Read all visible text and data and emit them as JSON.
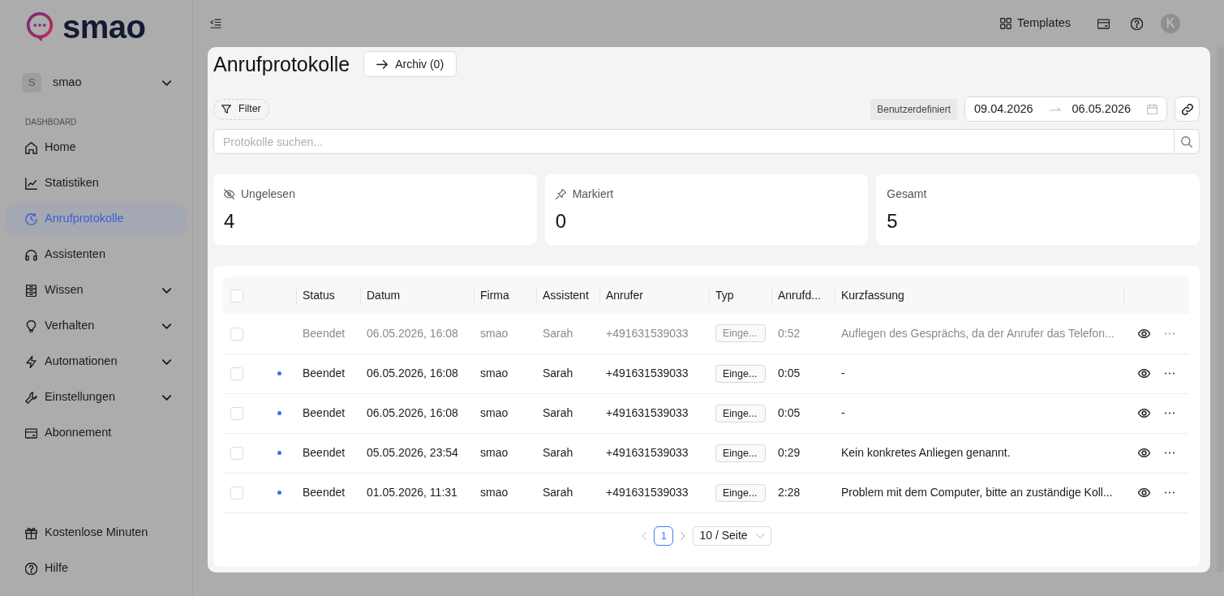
{
  "sidebar": {
    "logo_text": "smao",
    "workspace": {
      "initial": "S",
      "name": "smao"
    },
    "section": "DASHBOARD",
    "items": [
      {
        "label": "Home",
        "collapsible": false,
        "selected": false
      },
      {
        "label": "Statistiken",
        "collapsible": false,
        "selected": false
      },
      {
        "label": "Anrufprotokolle",
        "collapsible": false,
        "selected": true
      },
      {
        "label": "Assistenten",
        "collapsible": false,
        "selected": false
      },
      {
        "label": "Wissen",
        "collapsible": true,
        "selected": false
      },
      {
        "label": "Verhalten",
        "collapsible": true,
        "selected": false
      },
      {
        "label": "Automationen",
        "collapsible": true,
        "selected": false
      },
      {
        "label": "Einstellungen",
        "collapsible": true,
        "selected": false
      },
      {
        "label": "Abonnement",
        "collapsible": false,
        "selected": false
      }
    ],
    "footer_items": [
      {
        "label": "Kostenlose Minuten",
        "selected": false
      },
      {
        "label": "Hilfe",
        "selected": false
      }
    ]
  },
  "header": {
    "templates": "Templates",
    "avatar_initial": "K"
  },
  "page": {
    "title": "Anrufprotokolle",
    "archive_button": "Archiv (0)",
    "filter_button": "Filter",
    "range_preset": "Benutzerdefiniert",
    "date_from": "09.04.2026",
    "date_to": "06.05.2026",
    "search_placeholder": "Protokolle suchen..."
  },
  "stats": [
    {
      "label": "Ungelesen",
      "value": "4"
    },
    {
      "label": "Markiert",
      "value": "0"
    },
    {
      "label": "Gesamt",
      "value": "5"
    }
  ],
  "table": {
    "select_all_checked": false,
    "columns": [
      "Status",
      "Datum",
      "Firma",
      "Assistent",
      "Anrufer",
      "Typ",
      "Anrufd...",
      "Kurzfassung"
    ],
    "rows": [
      {
        "checked": false,
        "unread": false,
        "status": "Beendet",
        "date": "06.05.2026, 16:08",
        "company": "smao",
        "assistant": "Sarah",
        "caller": "+491631539033",
        "type": "Einge...",
        "duration": "0:52",
        "summary": "Auflegen des Gesprächs, da der Anrufer das Telefon..."
      },
      {
        "checked": false,
        "unread": true,
        "status": "Beendet",
        "date": "06.05.2026, 16:08",
        "company": "smao",
        "assistant": "Sarah",
        "caller": "+491631539033",
        "type": "Einge...",
        "duration": "0:05",
        "summary": "-"
      },
      {
        "checked": false,
        "unread": true,
        "status": "Beendet",
        "date": "06.05.2026, 16:08",
        "company": "smao",
        "assistant": "Sarah",
        "caller": "+491631539033",
        "type": "Einge...",
        "duration": "0:05",
        "summary": "-"
      },
      {
        "checked": false,
        "unread": true,
        "status": "Beendet",
        "date": "05.05.2026, 23:54",
        "company": "smao",
        "assistant": "Sarah",
        "caller": "+491631539033",
        "type": "Einge...",
        "duration": "0:29",
        "summary": "Kein konkretes Anliegen genannt."
      },
      {
        "checked": false,
        "unread": true,
        "status": "Beendet",
        "date": "01.05.2026, 11:31",
        "company": "smao",
        "assistant": "Sarah",
        "caller": "+491631539033",
        "type": "Einge...",
        "duration": "2:28",
        "summary": "Problem mit dem Computer, bitte an zuständige Koll..."
      }
    ]
  },
  "pagination": {
    "pages": [
      {
        "label": "1",
        "selected": true
      }
    ],
    "page_size": "10 / Seite"
  }
}
